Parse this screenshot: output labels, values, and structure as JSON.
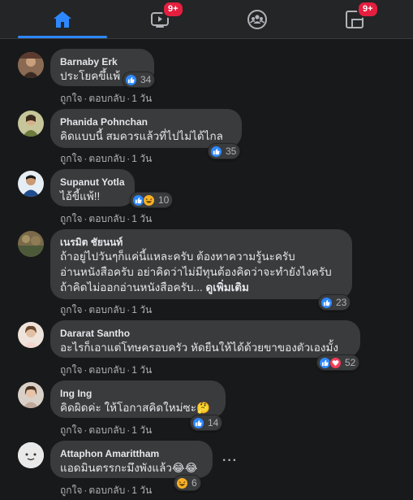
{
  "nav": {
    "tabs": [
      {
        "name": "home",
        "icon": "home-icon",
        "active": true
      },
      {
        "name": "watch",
        "icon": "video-icon",
        "badge": "9+"
      },
      {
        "name": "groups",
        "icon": "groups-icon"
      },
      {
        "name": "gaming",
        "icon": "gaming-icon",
        "badge": "9+"
      }
    ],
    "accent": "#2d88ff",
    "badge_color": "#e41e3f"
  },
  "comments": [
    {
      "author": "Barnaby Erk",
      "lines": [
        "ประโยคขึ้แพ้"
      ],
      "reactions": [
        "like"
      ],
      "count": "34",
      "actions": {
        "like": "ถูกใจ",
        "reply": "ตอบกลับ",
        "time": "1 วัน"
      }
    },
    {
      "author": "Phanida Pohnchan",
      "lines": [
        "คิดแบบนี้ สมควรแล้วที่ไปไม่ได้ไกล"
      ],
      "reactions": [
        "like"
      ],
      "count": "35",
      "actions": {
        "like": "ถูกใจ",
        "reply": "ตอบกลับ",
        "time": "1 วัน"
      }
    },
    {
      "author": "Supanut Yotla",
      "lines": [
        "ไอ้ขี้แพ้!!"
      ],
      "reactions": [
        "like",
        "haha"
      ],
      "count": "10",
      "actions": {
        "like": "ถูกใจ",
        "reply": "ตอบกลับ",
        "time": "1 วัน"
      }
    },
    {
      "author": "เนรมิต ชัยนนท์",
      "lines": [
        "ถ้าอยู่ไปวันๆก็แค่นี้แหละครับ ต้องหาความรู้นะครับ",
        "อ่านหนังสือครับ อย่าคิดว่าไม่มีทุนต้องคิดว่าจะทำยังไงครับ",
        "ถ้าคิดไม่ออกอ่านหนังสือครับ..."
      ],
      "see_more": "ดูเพิ่มเติม",
      "reactions": [
        "like"
      ],
      "count": "23",
      "actions": {
        "like": "ถูกใจ",
        "reply": "ตอบกลับ",
        "time": "1 วัน"
      }
    },
    {
      "author": "Dararat Santho",
      "lines": [
        "อะไรก็เอาแต่โทษครอบครัว หัดยืนให้ได้ด้วยขาของตัวเองมั้ง"
      ],
      "reactions": [
        "like",
        "love"
      ],
      "count": "52",
      "actions": {
        "like": "ถูกใจ",
        "reply": "ตอบกลับ",
        "time": "1 วัน"
      }
    },
    {
      "author": "Ing Ing",
      "lines": [
        "คิดผิดค่ะ ให้โอกาสคิดใหม่ซะ🤔"
      ],
      "reactions": [
        "like"
      ],
      "count": "14",
      "actions": {
        "like": "ถูกใจ",
        "reply": "ตอบกลับ",
        "time": "1 วัน"
      }
    },
    {
      "author": "Attaphon Amarittham",
      "lines": [
        "แอดมินตรรกะมึงพังแล้ว😂😂"
      ],
      "reactions": [
        "haha"
      ],
      "count": "6",
      "actions": {
        "like": "ถูกใจ",
        "reply": "ตอบกลับ",
        "time": "1 วัน"
      }
    }
  ]
}
